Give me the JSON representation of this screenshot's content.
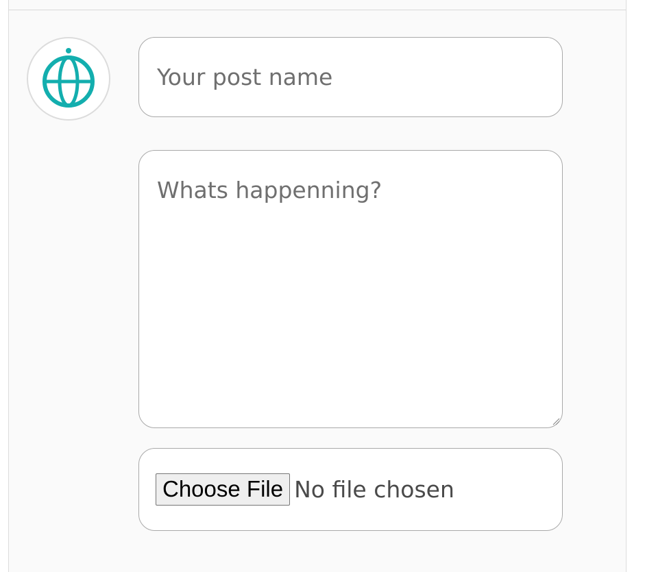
{
  "composer": {
    "avatar_icon": "globe-icon",
    "accent_color": "#13aeae",
    "post_name_placeholder": "Your post name",
    "post_body_placeholder": "Whats happenning?",
    "file_button_label": "Choose File",
    "file_status": "No file chosen"
  }
}
